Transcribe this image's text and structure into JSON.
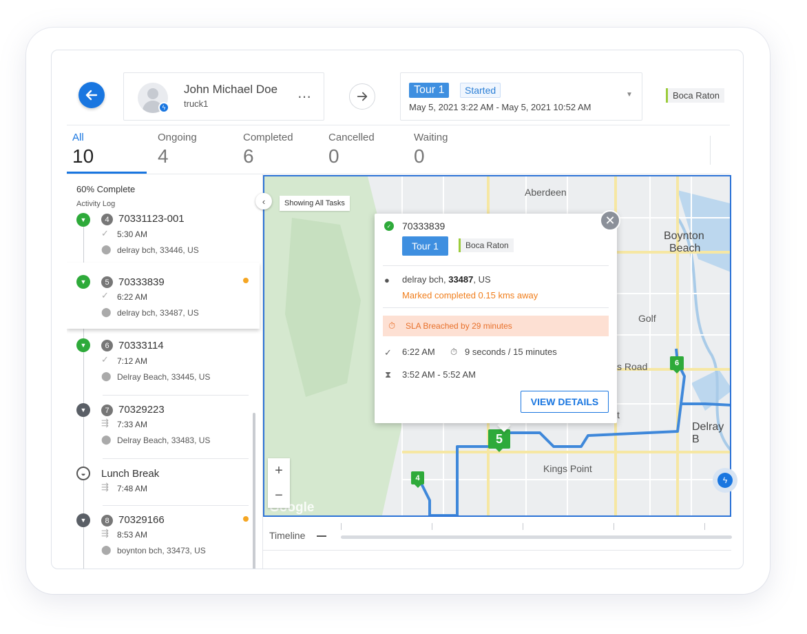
{
  "header": {
    "driver": {
      "name": "John Michael Doe",
      "vehicle": "truck1",
      "more_icon": "⋯"
    },
    "tour": {
      "label": "Tour 1",
      "status": "Started",
      "dates": "May 5, 2021 3:22 AM - May 5, 2021 10:52 AM"
    },
    "region": "Boca Raton"
  },
  "tabs": [
    {
      "label": "All",
      "count": "10",
      "active": true
    },
    {
      "label": "Ongoing",
      "count": "4"
    },
    {
      "label": "Completed",
      "count": "6"
    },
    {
      "label": "Cancelled",
      "count": "0"
    },
    {
      "label": "Waiting",
      "count": "0"
    }
  ],
  "panel": {
    "progress": "60% Complete",
    "activity_log": "Activity Log",
    "tasks": [
      {
        "num": "4",
        "id": "70331123-001",
        "time": "5:30 AM",
        "address": "delray bch, 33446, US",
        "status": "completed"
      },
      {
        "num": "5",
        "id": "70333839",
        "time": "6:22 AM",
        "address": "delray bch, 33487, US",
        "status": "completed",
        "flag": true
      },
      {
        "num": "6",
        "id": "70333114",
        "time": "7:12 AM",
        "address": "Delray Beach, 33445, US",
        "status": "completed"
      },
      {
        "num": "7",
        "id": "70329223",
        "time": "7:33 AM",
        "address": "Delray Beach, 33483, US",
        "status": "pending"
      },
      {
        "id": "Lunch Break",
        "time": "7:48 AM",
        "status": "break"
      },
      {
        "num": "8",
        "id": "70329166",
        "time": "8:53 AM",
        "address": "boynton bch, 33473, US",
        "status": "pending",
        "flag": true
      }
    ]
  },
  "map": {
    "showing": "Showing All Tasks",
    "labels": [
      "Aberdeen",
      "Boynton",
      "Beach",
      "Golf",
      "s Road",
      "t",
      "Delray B",
      "Kings Point"
    ],
    "credit": "Google",
    "zoom_in": "+",
    "zoom_out": "−",
    "markers": [
      "4",
      "5",
      "6"
    ]
  },
  "popup": {
    "id": "70333839",
    "tour": "Tour 1",
    "region": "Boca Raton",
    "address_city": "delray bch,",
    "address_zip": "33487",
    "address_country": ", US",
    "marked": "Marked completed 0.15 kms away",
    "sla": "SLA Breached by 29 minutes",
    "completed_time": "6:22 AM",
    "duration": "9 seconds / 15 minutes",
    "window": "3:52 AM - 5:52 AM",
    "view_details": "VIEW DETAILS",
    "close_icon": "✕"
  },
  "timeline": {
    "label": "Timeline"
  },
  "colors": {
    "accent": "#1976e0",
    "success": "#2eaa3a",
    "warning": "#f07d1a",
    "route": "#3f88da"
  }
}
